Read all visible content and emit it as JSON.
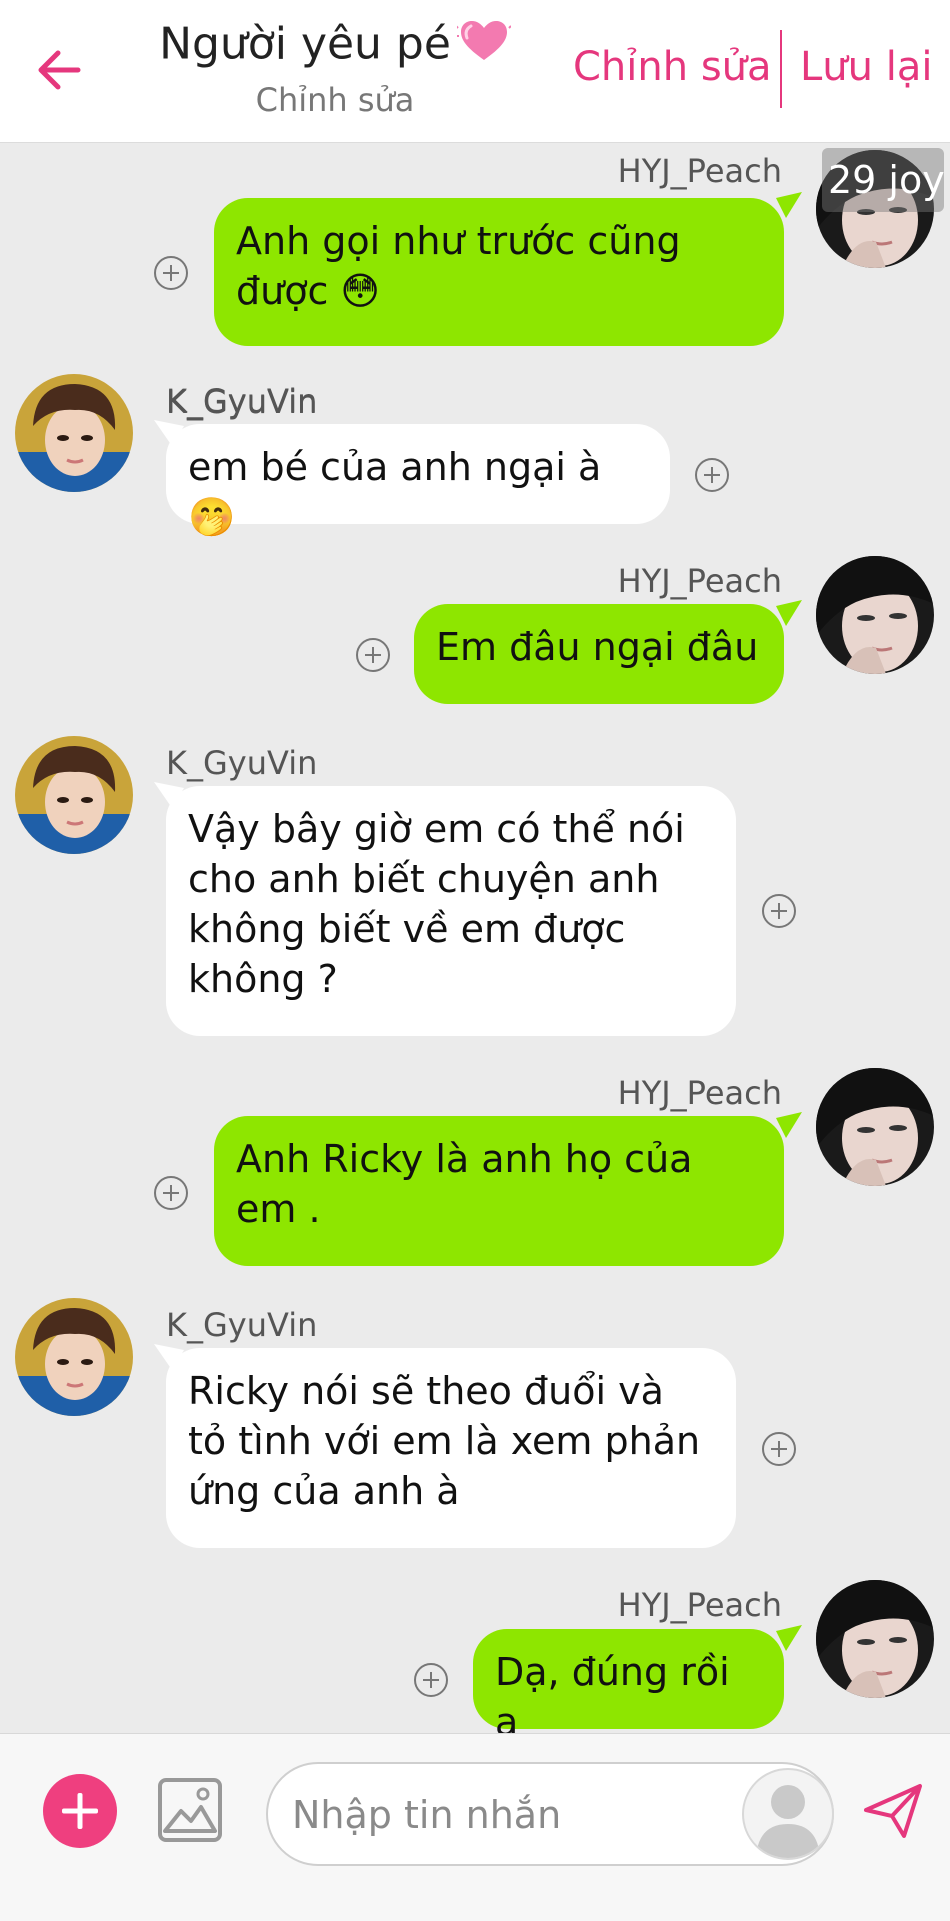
{
  "header": {
    "title": "Người yêu pé",
    "subtitle": "Chỉnh sửa",
    "edit_label": "Chỉnh sửa",
    "save_label": "Lưu lại"
  },
  "badge": "29 joy",
  "messages": [
    {
      "sender": "HYJ_Peach",
      "side": "right",
      "text": "Anh gọi như trước cũng được 😳"
    },
    {
      "sender": "K_GyuVin",
      "side": "left",
      "text": "em bé của anh ngại à 🤭"
    },
    {
      "sender": "HYJ_Peach",
      "side": "right",
      "text": "Em đâu ngại đâu"
    },
    {
      "sender": "K_GyuVin",
      "side": "left",
      "text": "Vậy bây giờ em có thể nói cho anh biết chuyện anh không biết về em được không ?"
    },
    {
      "sender": "HYJ_Peach",
      "side": "right",
      "text": " Anh Ricky là anh họ của em ."
    },
    {
      "sender": "K_GyuVin",
      "side": "left",
      "text": " Ricky nói sẽ theo đuổi và tỏ tình với em là xem phản ứng của anh à"
    },
    {
      "sender": "HYJ_Peach",
      "side": "right",
      "text": "Dạ, đúng rồi ạ"
    }
  ],
  "composer": {
    "placeholder": "Nhập tin nhắn"
  },
  "colors": {
    "accent": "#e5377d",
    "bubble_right": "#8ee600",
    "bubble_left": "#ffffff",
    "background": "#ebebeb"
  },
  "icons": {
    "back": "arrow-left-icon",
    "add": "plus-icon",
    "image": "image-icon",
    "profile": "person-icon",
    "send": "send-icon",
    "heart": "heart-icon"
  }
}
